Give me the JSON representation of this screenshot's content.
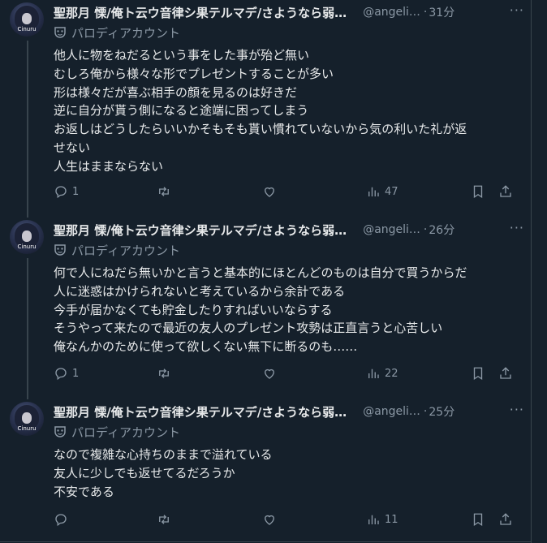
{
  "tweets": [
    {
      "name": "聖那月 慄/俺ト云ウ音律シ果テルマデ/さようなら弱…",
      "handle": "@angeli…",
      "dot": "·",
      "time": "31分",
      "parody_label": "パロディアカウント",
      "avatar_text": "Cinuru",
      "lines": [
        "他人に物をねだるという事をした事が殆ど無い",
        "むしろ俺から様々な形でプレゼントすることが多い",
        "形は様々だが喜ぶ相手の顔を見るのは好きだ",
        "逆に自分が貰う側になると途端に困ってしまう",
        "お返しはどうしたらいいかそもそも貰い慣れていないから気の利いた礼が返",
        "せない",
        "人生はままならない"
      ],
      "replies": "1",
      "retweets": "",
      "likes": "",
      "views": "47"
    },
    {
      "name": "聖那月 慄/俺ト云ウ音律シ果テルマデ/さようなら弱…",
      "handle": "@angeli…",
      "dot": "·",
      "time": "26分",
      "parody_label": "パロディアカウント",
      "avatar_text": "Cinuru",
      "lines": [
        "何で人にねだら無いかと言うと基本的にほとんどのものは自分で買うからだ",
        "人に迷惑はかけられないと考えているから余計である",
        "今手が届かなくても貯金したりすればいいならする",
        "そうやって来たので最近の友人のプレゼント攻勢は正直言うと心苦しい",
        "俺なんかのために使って欲しくない無下に断るのも……"
      ],
      "replies": "1",
      "retweets": "",
      "likes": "",
      "views": "22"
    },
    {
      "name": "聖那月 慄/俺ト云ウ音律シ果テルマデ/さようなら弱…",
      "handle": "@angeli…",
      "dot": "·",
      "time": "25分",
      "parody_label": "パロディアカウント",
      "avatar_text": "Cinuru",
      "lines": [
        "なので複雑な心持ちのままで溢れている",
        "友人に少しでも返せてるだろうか",
        "不安である"
      ],
      "replies": "",
      "retweets": "",
      "likes": "",
      "views": "11"
    }
  ],
  "more_icon": "···",
  "icons": [
    "reply-icon",
    "retweet-icon",
    "like-icon",
    "views-icon",
    "bookmark-icon",
    "share-icon",
    "parody-mask-icon",
    "more-icon"
  ],
  "colors": {
    "background": "#15202b",
    "text": "#e7e9ea",
    "muted": "#8b98a5",
    "border": "#38444d"
  }
}
